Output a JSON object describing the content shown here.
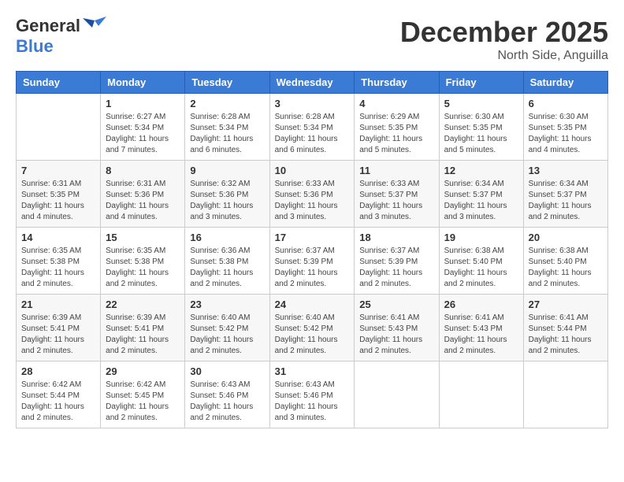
{
  "header": {
    "logo_general": "General",
    "logo_blue": "Blue",
    "month_title": "December 2025",
    "location": "North Side, Anguilla"
  },
  "weekdays": [
    "Sunday",
    "Monday",
    "Tuesday",
    "Wednesday",
    "Thursday",
    "Friday",
    "Saturday"
  ],
  "weeks": [
    [
      {
        "day": "",
        "sunrise": "",
        "sunset": "",
        "daylight": ""
      },
      {
        "day": "1",
        "sunrise": "Sunrise: 6:27 AM",
        "sunset": "Sunset: 5:34 PM",
        "daylight": "Daylight: 11 hours and 7 minutes."
      },
      {
        "day": "2",
        "sunrise": "Sunrise: 6:28 AM",
        "sunset": "Sunset: 5:34 PM",
        "daylight": "Daylight: 11 hours and 6 minutes."
      },
      {
        "day": "3",
        "sunrise": "Sunrise: 6:28 AM",
        "sunset": "Sunset: 5:34 PM",
        "daylight": "Daylight: 11 hours and 6 minutes."
      },
      {
        "day": "4",
        "sunrise": "Sunrise: 6:29 AM",
        "sunset": "Sunset: 5:35 PM",
        "daylight": "Daylight: 11 hours and 5 minutes."
      },
      {
        "day": "5",
        "sunrise": "Sunrise: 6:30 AM",
        "sunset": "Sunset: 5:35 PM",
        "daylight": "Daylight: 11 hours and 5 minutes."
      },
      {
        "day": "6",
        "sunrise": "Sunrise: 6:30 AM",
        "sunset": "Sunset: 5:35 PM",
        "daylight": "Daylight: 11 hours and 4 minutes."
      }
    ],
    [
      {
        "day": "7",
        "sunrise": "Sunrise: 6:31 AM",
        "sunset": "Sunset: 5:35 PM",
        "daylight": "Daylight: 11 hours and 4 minutes."
      },
      {
        "day": "8",
        "sunrise": "Sunrise: 6:31 AM",
        "sunset": "Sunset: 5:36 PM",
        "daylight": "Daylight: 11 hours and 4 minutes."
      },
      {
        "day": "9",
        "sunrise": "Sunrise: 6:32 AM",
        "sunset": "Sunset: 5:36 PM",
        "daylight": "Daylight: 11 hours and 3 minutes."
      },
      {
        "day": "10",
        "sunrise": "Sunrise: 6:33 AM",
        "sunset": "Sunset: 5:36 PM",
        "daylight": "Daylight: 11 hours and 3 minutes."
      },
      {
        "day": "11",
        "sunrise": "Sunrise: 6:33 AM",
        "sunset": "Sunset: 5:37 PM",
        "daylight": "Daylight: 11 hours and 3 minutes."
      },
      {
        "day": "12",
        "sunrise": "Sunrise: 6:34 AM",
        "sunset": "Sunset: 5:37 PM",
        "daylight": "Daylight: 11 hours and 3 minutes."
      },
      {
        "day": "13",
        "sunrise": "Sunrise: 6:34 AM",
        "sunset": "Sunset: 5:37 PM",
        "daylight": "Daylight: 11 hours and 2 minutes."
      }
    ],
    [
      {
        "day": "14",
        "sunrise": "Sunrise: 6:35 AM",
        "sunset": "Sunset: 5:38 PM",
        "daylight": "Daylight: 11 hours and 2 minutes."
      },
      {
        "day": "15",
        "sunrise": "Sunrise: 6:35 AM",
        "sunset": "Sunset: 5:38 PM",
        "daylight": "Daylight: 11 hours and 2 minutes."
      },
      {
        "day": "16",
        "sunrise": "Sunrise: 6:36 AM",
        "sunset": "Sunset: 5:38 PM",
        "daylight": "Daylight: 11 hours and 2 minutes."
      },
      {
        "day": "17",
        "sunrise": "Sunrise: 6:37 AM",
        "sunset": "Sunset: 5:39 PM",
        "daylight": "Daylight: 11 hours and 2 minutes."
      },
      {
        "day": "18",
        "sunrise": "Sunrise: 6:37 AM",
        "sunset": "Sunset: 5:39 PM",
        "daylight": "Daylight: 11 hours and 2 minutes."
      },
      {
        "day": "19",
        "sunrise": "Sunrise: 6:38 AM",
        "sunset": "Sunset: 5:40 PM",
        "daylight": "Daylight: 11 hours and 2 minutes."
      },
      {
        "day": "20",
        "sunrise": "Sunrise: 6:38 AM",
        "sunset": "Sunset: 5:40 PM",
        "daylight": "Daylight: 11 hours and 2 minutes."
      }
    ],
    [
      {
        "day": "21",
        "sunrise": "Sunrise: 6:39 AM",
        "sunset": "Sunset: 5:41 PM",
        "daylight": "Daylight: 11 hours and 2 minutes."
      },
      {
        "day": "22",
        "sunrise": "Sunrise: 6:39 AM",
        "sunset": "Sunset: 5:41 PM",
        "daylight": "Daylight: 11 hours and 2 minutes."
      },
      {
        "day": "23",
        "sunrise": "Sunrise: 6:40 AM",
        "sunset": "Sunset: 5:42 PM",
        "daylight": "Daylight: 11 hours and 2 minutes."
      },
      {
        "day": "24",
        "sunrise": "Sunrise: 6:40 AM",
        "sunset": "Sunset: 5:42 PM",
        "daylight": "Daylight: 11 hours and 2 minutes."
      },
      {
        "day": "25",
        "sunrise": "Sunrise: 6:41 AM",
        "sunset": "Sunset: 5:43 PM",
        "daylight": "Daylight: 11 hours and 2 minutes."
      },
      {
        "day": "26",
        "sunrise": "Sunrise: 6:41 AM",
        "sunset": "Sunset: 5:43 PM",
        "daylight": "Daylight: 11 hours and 2 minutes."
      },
      {
        "day": "27",
        "sunrise": "Sunrise: 6:41 AM",
        "sunset": "Sunset: 5:44 PM",
        "daylight": "Daylight: 11 hours and 2 minutes."
      }
    ],
    [
      {
        "day": "28",
        "sunrise": "Sunrise: 6:42 AM",
        "sunset": "Sunset: 5:44 PM",
        "daylight": "Daylight: 11 hours and 2 minutes."
      },
      {
        "day": "29",
        "sunrise": "Sunrise: 6:42 AM",
        "sunset": "Sunset: 5:45 PM",
        "daylight": "Daylight: 11 hours and 2 minutes."
      },
      {
        "day": "30",
        "sunrise": "Sunrise: 6:43 AM",
        "sunset": "Sunset: 5:46 PM",
        "daylight": "Daylight: 11 hours and 2 minutes."
      },
      {
        "day": "31",
        "sunrise": "Sunrise: 6:43 AM",
        "sunset": "Sunset: 5:46 PM",
        "daylight": "Daylight: 11 hours and 3 minutes."
      },
      {
        "day": "",
        "sunrise": "",
        "sunset": "",
        "daylight": ""
      },
      {
        "day": "",
        "sunrise": "",
        "sunset": "",
        "daylight": ""
      },
      {
        "day": "",
        "sunrise": "",
        "sunset": "",
        "daylight": ""
      }
    ]
  ]
}
